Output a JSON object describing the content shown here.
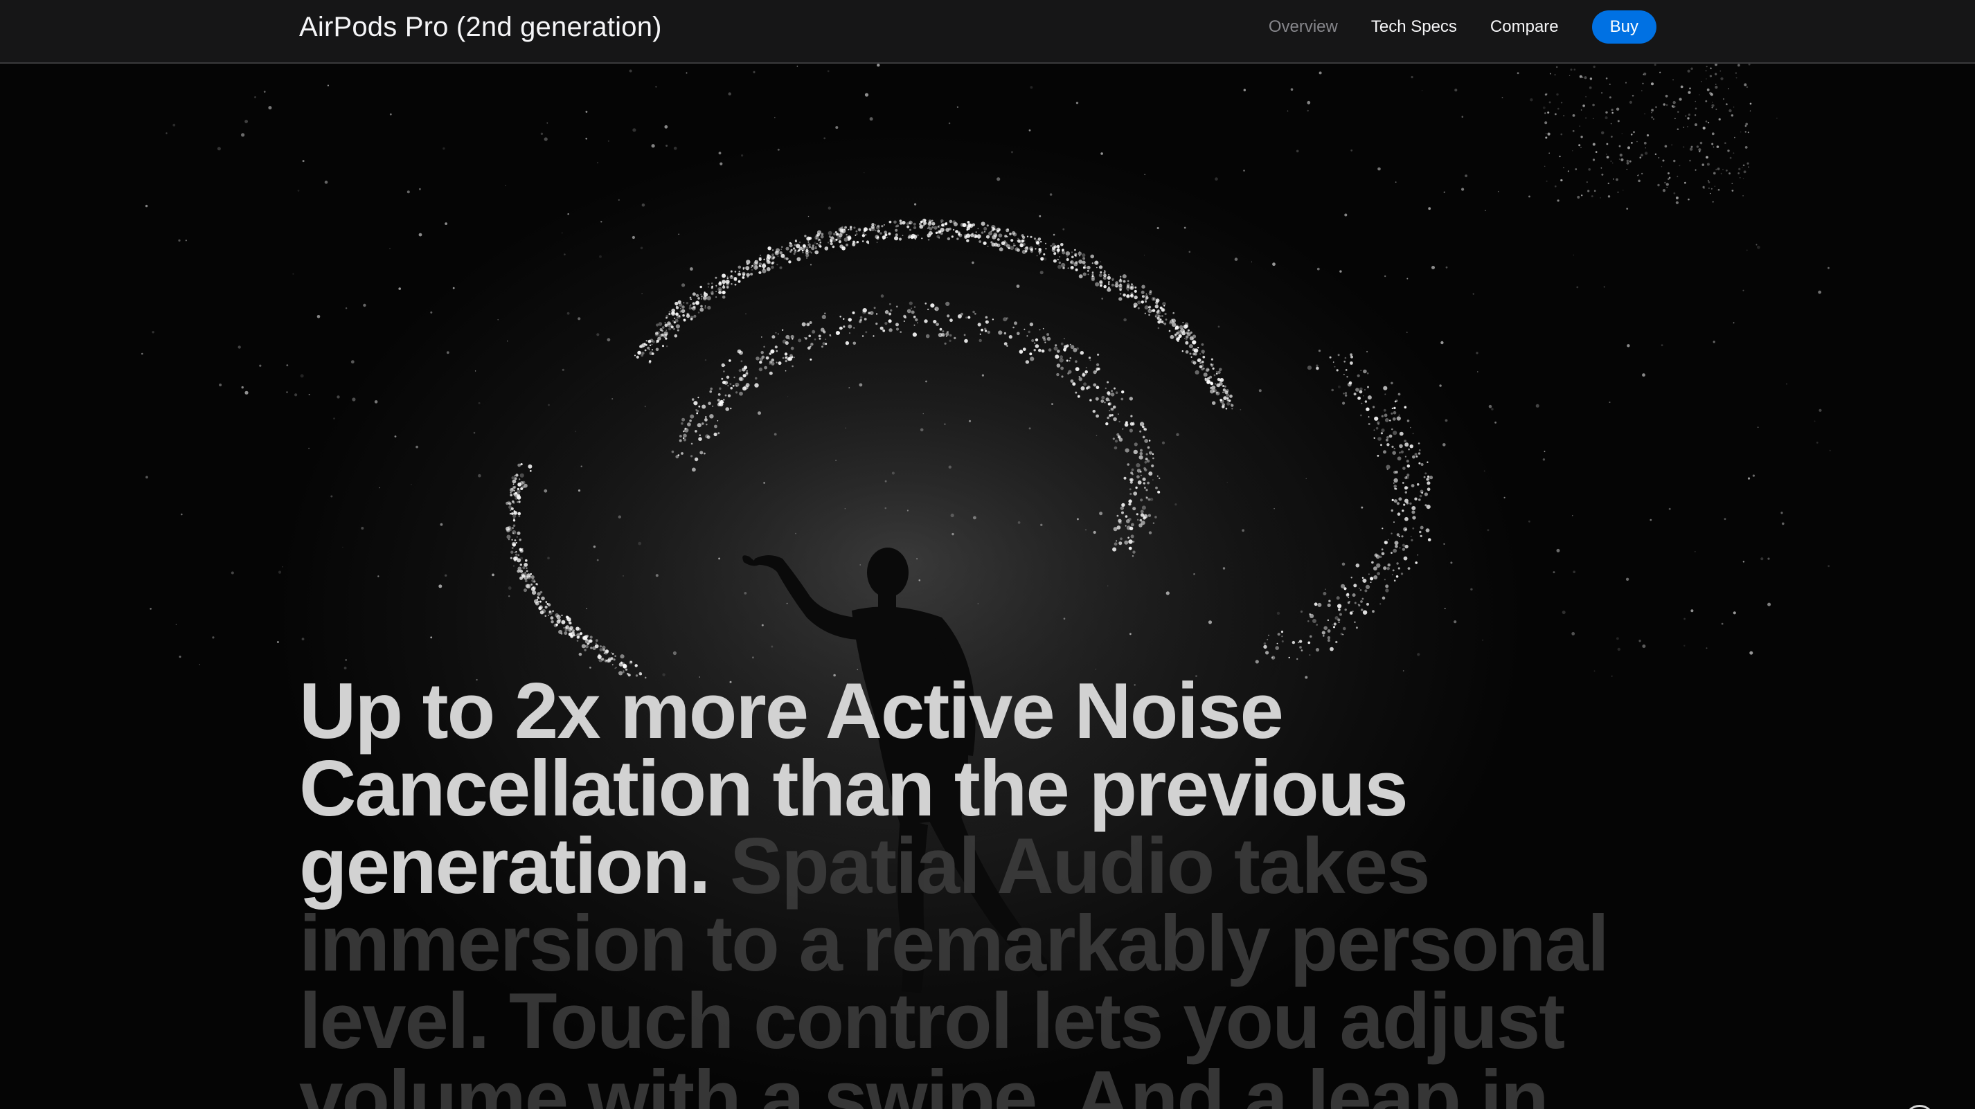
{
  "nav": {
    "title": "AirPods Pro (2nd generation)",
    "links": [
      {
        "label": "Overview",
        "current": true
      },
      {
        "label": "Tech Specs",
        "current": false
      },
      {
        "label": "Compare",
        "current": false
      }
    ],
    "buy_label": "Buy"
  },
  "hero": {
    "headline_bright": "Up to 2x more Active Noise Cancellation than the previous generation.",
    "headline_dim": " Spatial Audio takes immersion to a remarkably personal level. Touch control lets you adjust volume with a swipe. And a leap in"
  },
  "controls": {
    "pause_icon": "pause-icon"
  },
  "colors": {
    "accent": "#0071e3",
    "nav_bg": "#161617",
    "headline_bright": "#d2d2d2",
    "headline_dim": "#3c3c3c"
  }
}
